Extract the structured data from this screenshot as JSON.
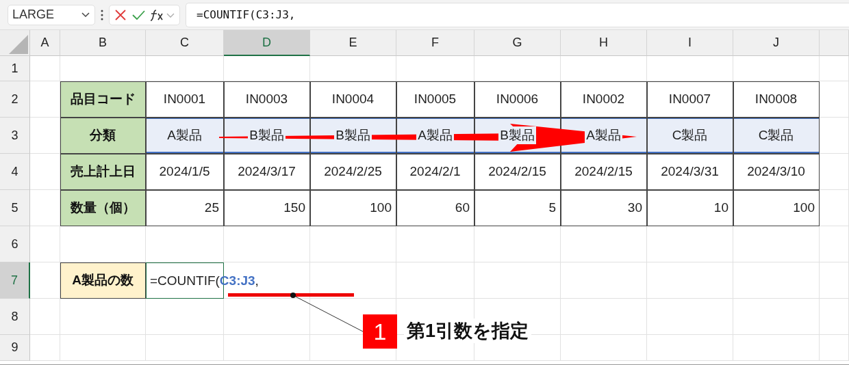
{
  "formula_bar": {
    "name_box": "LARGE",
    "formula": "=COUNTIF(C3:J3,"
  },
  "column_headers": [
    {
      "label": "A",
      "selected": false
    },
    {
      "label": "B",
      "selected": false
    },
    {
      "label": "C",
      "selected": false
    },
    {
      "label": "D",
      "selected": true
    },
    {
      "label": "E",
      "selected": false
    },
    {
      "label": "F",
      "selected": false
    },
    {
      "label": "G",
      "selected": false
    },
    {
      "label": "H",
      "selected": false
    },
    {
      "label": "I",
      "selected": false
    },
    {
      "label": "J",
      "selected": false
    }
  ],
  "row_headers": [
    {
      "label": "1",
      "selected": false
    },
    {
      "label": "2",
      "selected": false
    },
    {
      "label": "3",
      "selected": false
    },
    {
      "label": "4",
      "selected": false
    },
    {
      "label": "5",
      "selected": false
    },
    {
      "label": "6",
      "selected": false
    },
    {
      "label": "7",
      "selected": true
    },
    {
      "label": "8",
      "selected": false
    },
    {
      "label": "9",
      "selected": false
    }
  ],
  "table": {
    "rows": [
      {
        "label": "品目コード",
        "kind": "text",
        "selected": false,
        "cells": [
          "IN0001",
          "IN0003",
          "IN0004",
          "IN0005",
          "IN0006",
          "IN0002",
          "IN0007",
          "IN0008"
        ]
      },
      {
        "label": "分類",
        "kind": "text",
        "selected": true,
        "cells": [
          "A製品",
          "B製品",
          "B製品",
          "A製品",
          "B製品",
          "A製品",
          "C製品",
          "C製品"
        ]
      },
      {
        "label": "売上計上日",
        "kind": "text",
        "selected": false,
        "cells": [
          "2024/1/5",
          "2024/3/17",
          "2024/2/25",
          "2024/2/1",
          "2024/2/15",
          "2024/2/15",
          "2024/3/31",
          "2024/3/10"
        ]
      },
      {
        "label": "数量（個）",
        "kind": "number",
        "selected": false,
        "cells": [
          "25",
          "150",
          "100",
          "60",
          "5",
          "30",
          "10",
          "100"
        ]
      }
    ]
  },
  "summary": {
    "label": "A製品の数",
    "formula_start": "=COUNTIF(",
    "reference": "C3:J3",
    "formula_end": ","
  },
  "callout": {
    "number": "1",
    "text": "第1引数を指定"
  }
}
